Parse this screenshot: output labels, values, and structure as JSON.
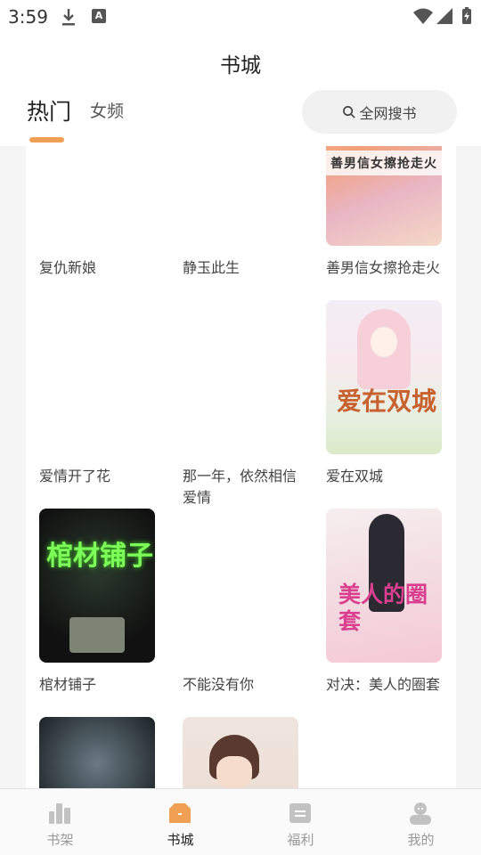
{
  "status_bar": {
    "time": "3:59",
    "notif_letter": "A"
  },
  "header": {
    "title": "书城",
    "tabs": [
      {
        "label": "热门",
        "active": true
      },
      {
        "label": "女频",
        "active": false
      }
    ],
    "search_label": "全网搜书",
    "accent": "#f0a054"
  },
  "books": [
    {
      "title": "复仇新娘",
      "cover": "none"
    },
    {
      "title": "静玉此生",
      "cover": "none"
    },
    {
      "title": "善男信女擦抢走火",
      "cover": "anime-flowers",
      "cover_text": "善男信女擦抢走火"
    },
    {
      "title": "爱情开了花",
      "cover": "none"
    },
    {
      "title": "那一年，依然相信爱情",
      "cover": "none"
    },
    {
      "title": "爱在双城",
      "cover": "anime-girl",
      "cover_text": "爱在双城"
    },
    {
      "title": "棺材铺子",
      "cover": "horror-neon",
      "cover_text": "棺材铺子"
    },
    {
      "title": "不能没有你",
      "cover": "none"
    },
    {
      "title": "对决：美人的圈套",
      "cover": "romance-woman",
      "cover_text": "美人的圈套"
    },
    {
      "title": "",
      "cover": "dark"
    },
    {
      "title": "",
      "cover": "anime-boy"
    }
  ],
  "bottom_nav": [
    {
      "label": "书架",
      "icon": "bookshelf-icon",
      "active": false
    },
    {
      "label": "书城",
      "icon": "bookstore-icon",
      "active": true
    },
    {
      "label": "福利",
      "icon": "gift-icon",
      "active": false
    },
    {
      "label": "我的",
      "icon": "profile-icon",
      "active": false
    }
  ]
}
